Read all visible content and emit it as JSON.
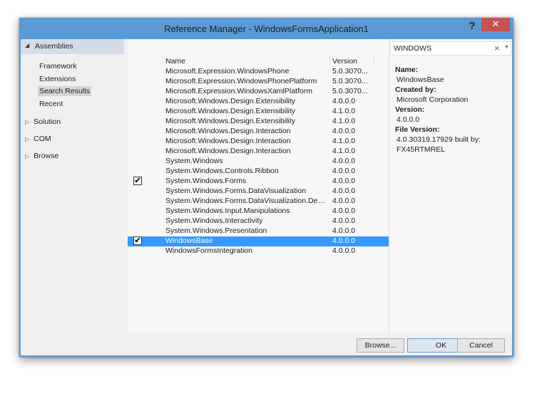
{
  "window": {
    "title": "Reference Manager - WindowsFormsApplication1",
    "help_glyph": "?",
    "close_glyph": "✕"
  },
  "nav": {
    "section": "Assemblies",
    "subitems": [
      {
        "label": "Framework",
        "selected": false
      },
      {
        "label": "Extensions",
        "selected": false
      },
      {
        "label": "Search Results",
        "selected": true
      },
      {
        "label": "Recent",
        "selected": false
      }
    ],
    "groups": [
      {
        "label": "Solution"
      },
      {
        "label": "COM"
      },
      {
        "label": "Browse"
      }
    ]
  },
  "list": {
    "columns": {
      "name": "Name",
      "version": "Version"
    },
    "rows": [
      {
        "name": "Microsoft.Expression.WindowsPhone",
        "version": "5.0.3070...",
        "checked": false,
        "selected": false
      },
      {
        "name": "Microsoft.Expression.WindowsPhonePlatform",
        "version": "5.0.3070...",
        "checked": false,
        "selected": false
      },
      {
        "name": "Microsoft.Expression.WindowsXamlPlatform",
        "version": "5.0.3070...",
        "checked": false,
        "selected": false
      },
      {
        "name": "Microsoft.Windows.Design.Extensibility",
        "version": "4.0.0.0",
        "checked": false,
        "selected": false
      },
      {
        "name": "Microsoft.Windows.Design.Extensibility",
        "version": "4.1.0.0",
        "checked": false,
        "selected": false
      },
      {
        "name": "Microsoft.Windows.Design.Extensibility",
        "version": "4.1.0.0",
        "checked": false,
        "selected": false
      },
      {
        "name": "Microsoft.Windows.Design.Interaction",
        "version": "4.0.0.0",
        "checked": false,
        "selected": false
      },
      {
        "name": "Microsoft.Windows.Design.Interaction",
        "version": "4.1.0.0",
        "checked": false,
        "selected": false
      },
      {
        "name": "Microsoft.Windows.Design.Interaction",
        "version": "4.1.0.0",
        "checked": false,
        "selected": false
      },
      {
        "name": "System.Windows",
        "version": "4.0.0.0",
        "checked": false,
        "selected": false
      },
      {
        "name": "System.Windows.Controls.Ribbon",
        "version": "4.0.0.0",
        "checked": false,
        "selected": false
      },
      {
        "name": "System.Windows.Forms",
        "version": "4.0.0.0",
        "checked": true,
        "selected": false
      },
      {
        "name": "System.Windows.Forms.DataVisualization",
        "version": "4.0.0.0",
        "checked": false,
        "selected": false
      },
      {
        "name": "System.Windows.Forms.DataVisualization.Desi...",
        "version": "4.0.0.0",
        "checked": false,
        "selected": false
      },
      {
        "name": "System.Windows.Input.Manipulations",
        "version": "4.0.0.0",
        "checked": false,
        "selected": false
      },
      {
        "name": "System.Windows.Interactivity",
        "version": "4.0.0.0",
        "checked": false,
        "selected": false
      },
      {
        "name": "System.Windows.Presentation",
        "version": "4.0.0.0",
        "checked": false,
        "selected": false
      },
      {
        "name": "WindowsBase",
        "version": "4.0.0.0",
        "checked": true,
        "selected": true
      },
      {
        "name": "WindowsFormsIntegration",
        "version": "4.0.0.0",
        "checked": false,
        "selected": false
      }
    ]
  },
  "search": {
    "value": "WINDOWS",
    "clear_glyph": "×",
    "dropdown_glyph": "▼"
  },
  "details": {
    "name_label": "Name:",
    "name_value": "WindowsBase",
    "created_label": "Created by:",
    "created_value": "Microsoft Corporation",
    "version_label": "Version:",
    "version_value": "4.0.0.0",
    "file_version_label": "File Version:",
    "file_version_line1": "4.0.30319.17929 built by:",
    "file_version_line2": "FX45RTMREL"
  },
  "buttons": {
    "browse": "Browse...",
    "ok": "OK",
    "cancel": "Cancel"
  },
  "glyphs": {
    "expanded": "◢",
    "collapsed": "▷",
    "check": "✔"
  },
  "colors": {
    "frame": "#5b9bd5",
    "selection": "#3399ff",
    "close": "#c75050"
  }
}
